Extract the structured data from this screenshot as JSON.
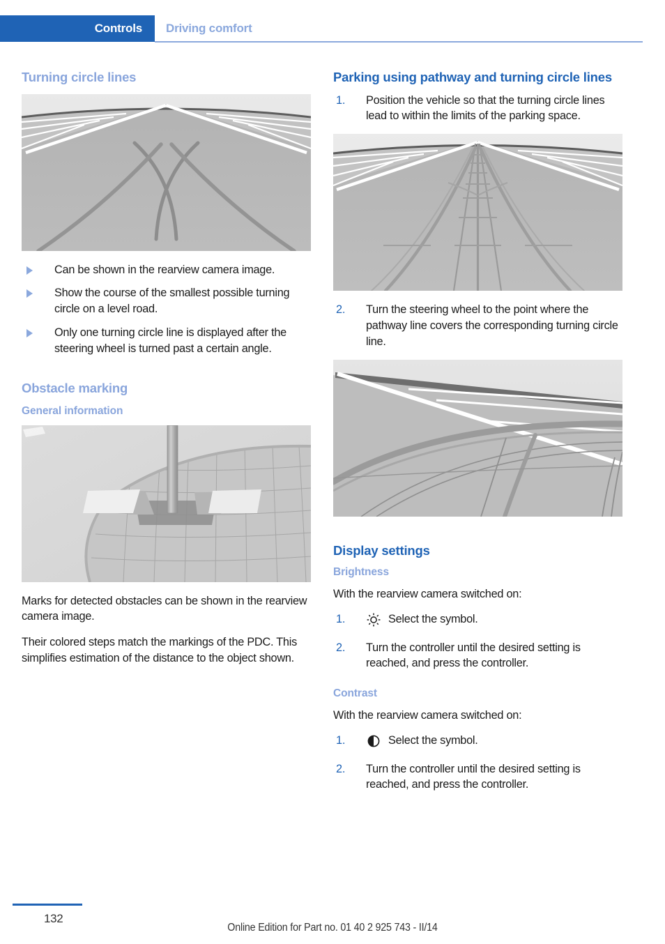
{
  "header": {
    "tab_label": "Controls",
    "section_label": "Driving comfort"
  },
  "left_column": {
    "heading_turning": "Turning circle lines",
    "figure_turning_alt": "Rearview camera view of road with two crossing turning circle lines forming an X",
    "bullets": [
      "Can be shown in the rearview camera image.",
      "Show the course of the smallest possible turning circle on a level road.",
      "Only one turning circle line is displayed after the steering wheel is turned past a certain angle."
    ],
    "heading_obstacle": "Obstacle marking",
    "subheading_general": "General information",
    "figure_obstacle_alt": "Rearview camera view of a pole on cobblestone paving with obstacle marking blocks",
    "paragraphs": [
      "Marks for detected obstacles can be shown in the rearview camera image.",
      "Their colored steps match the markings of the PDC. This simplifies estimation of the distance to the object shown."
    ]
  },
  "right_column": {
    "heading_parking": "Parking using pathway and turning circle lines",
    "steps_parking": [
      {
        "num": "1.",
        "text": "Position the vehicle so that the turning circle lines lead to within the limits of the parking space."
      },
      {
        "num": "2.",
        "text": "Turn the steering wheel to the point where the pathway line covers the corresponding turning circle line."
      }
    ],
    "figure_pathway_alt": "Rearview camera view with pathway ladder lines and turning circle lines converging",
    "figure_aligned_alt": "Rearview camera view where the pathway line covers the turning circle line",
    "heading_display": "Display settings",
    "subheading_brightness": "Brightness",
    "brightness_intro": "With the rearview camera switched on:",
    "steps_brightness": [
      {
        "num": "1.",
        "icon": "brightness-sun-icon",
        "text": "Select the symbol."
      },
      {
        "num": "2.",
        "icon": "",
        "text": "Turn the controller until the desired setting is reached, and press the controller."
      }
    ],
    "subheading_contrast": "Contrast",
    "contrast_intro": "With the rearview camera switched on:",
    "steps_contrast": [
      {
        "num": "1.",
        "icon": "contrast-half-circle-icon",
        "text": "Select the symbol."
      },
      {
        "num": "2.",
        "icon": "",
        "text": "Turn the controller until the desired setting is reached, and press the controller."
      }
    ]
  },
  "footer": {
    "page_number": "132",
    "note": "Online Edition for Part no. 01 40 2 925 743 - II/14"
  },
  "colors": {
    "brand_blue": "#1f63b5",
    "light_blue": "#89a5dc",
    "text": "#1a1a1a"
  }
}
